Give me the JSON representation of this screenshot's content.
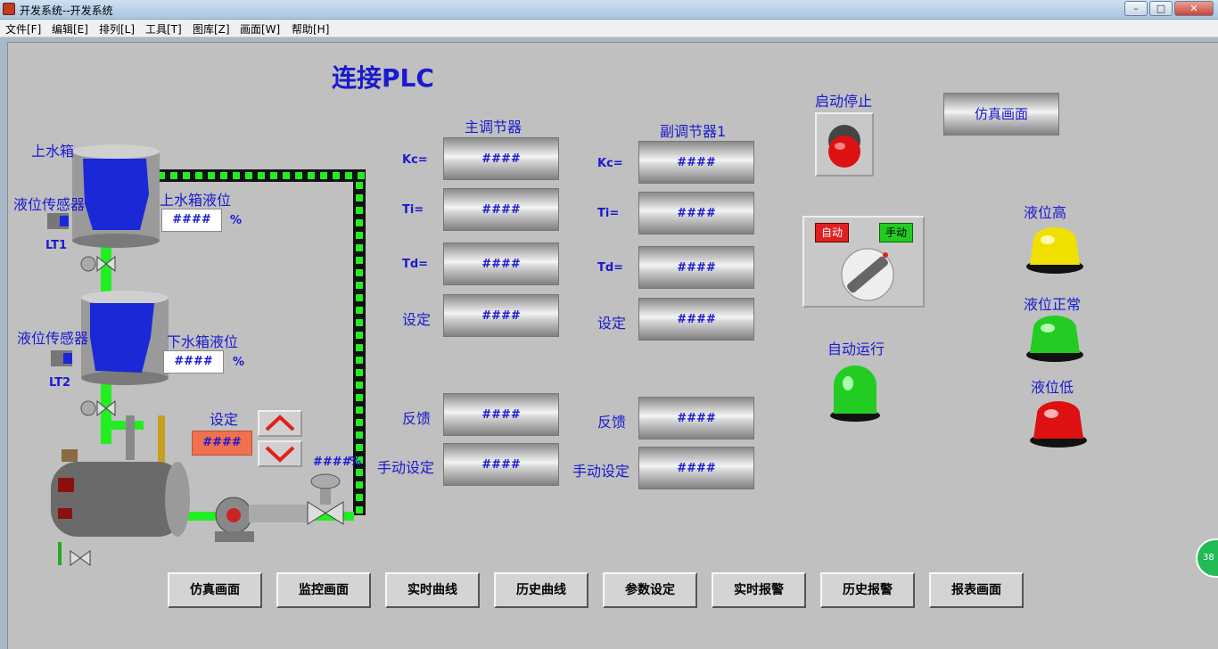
{
  "window": {
    "title": "开发系统--开发系统",
    "minimize": "–",
    "maximize": "□",
    "close": "✕"
  },
  "menu": [
    "文件[F]",
    "编辑[E]",
    "排列[L]",
    "工具[T]",
    "图库[Z]",
    "画面[W]",
    "帮助[H]"
  ],
  "header": {
    "title": "连接PLC"
  },
  "tanks": {
    "upper_label": "上水箱",
    "upper_sensor": "液位传感器",
    "upper_sensor_tag": "LT1",
    "upper_level_label": "上水箱液位",
    "upper_level_value": "####",
    "upper_unit": "%",
    "lower_sensor": "液位传感器",
    "lower_sensor_tag": "LT2",
    "lower_level_label": "下水箱液位",
    "lower_level_value": "####",
    "lower_unit": "%",
    "setpoint_label": "设定",
    "setpoint_value": "####",
    "valve_value": "####",
    "valve_unit": "%"
  },
  "master": {
    "title": "主调节器",
    "rows": [
      {
        "label": "Kc=",
        "value": "####"
      },
      {
        "label": "Ti=",
        "value": "####"
      },
      {
        "label": "Td=",
        "value": "####"
      },
      {
        "label": "设定",
        "value": "####"
      },
      {
        "label": "反馈",
        "value": "####"
      },
      {
        "label": "手动设定",
        "value": "####"
      }
    ]
  },
  "slave": {
    "title": "副调节器1",
    "rows": [
      {
        "label": "Kc=",
        "value": "####"
      },
      {
        "label": "Ti=",
        "value": "####"
      },
      {
        "label": "Td=",
        "value": "####"
      },
      {
        "label": "设定",
        "value": "####"
      },
      {
        "label": "反馈",
        "value": "####"
      },
      {
        "label": "手动设定",
        "value": "####"
      }
    ]
  },
  "controls": {
    "start_stop_label": "启动停止",
    "sim_button": "仿真画面",
    "auto_tag": "自动",
    "manual_tag": "手动",
    "auto_run_label": "自动运行",
    "level_high": "液位高",
    "level_normal": "液位正常",
    "level_low": "液位低"
  },
  "nav": [
    "仿真画面",
    "监控画面",
    "实时曲线",
    "历史曲线",
    "参数设定",
    "实时报警",
    "历史报警",
    "报表画面"
  ],
  "side_badge": "38",
  "colors": {
    "label_blue": "#1a1ad0",
    "setpoint_box": "#f07050",
    "lamp_green": "#22cc22",
    "lamp_red": "#dd1111",
    "lamp_yellow": "#f0e000"
  }
}
